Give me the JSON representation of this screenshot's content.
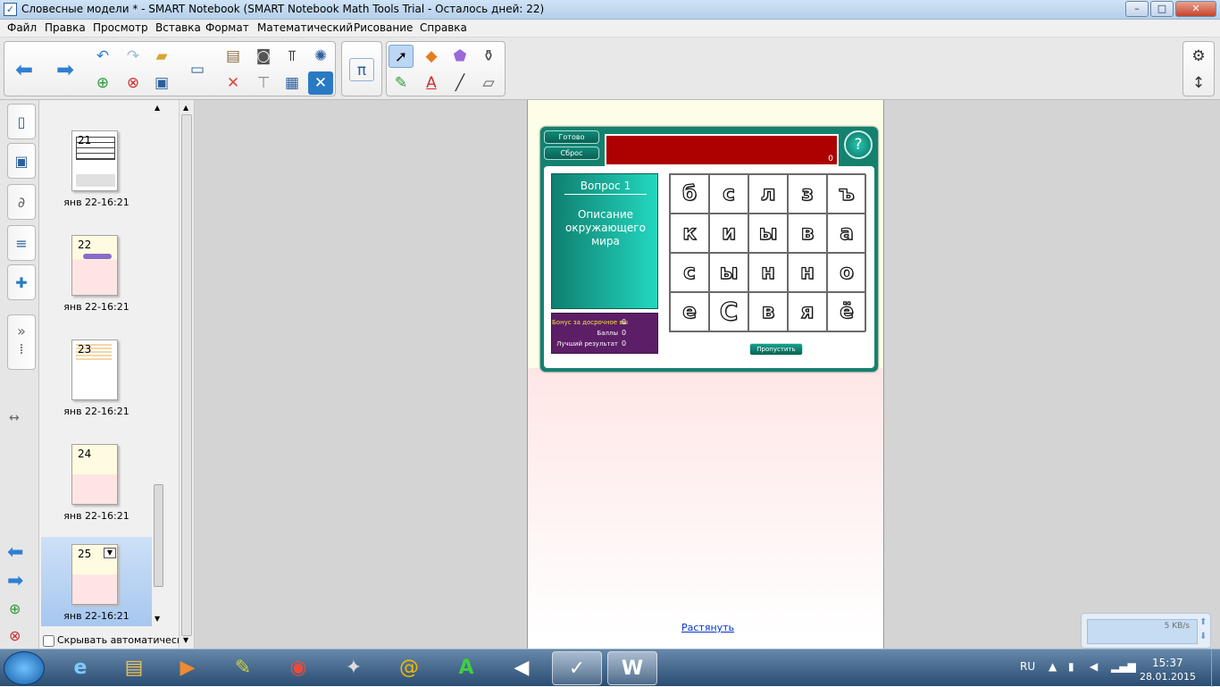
{
  "window": {
    "title": "Словесные модели * - SMART Notebook (SMART Notebook Math Tools Trial - Осталось дней: 22)",
    "minimize": "–",
    "maximize": "□",
    "close": "✕"
  },
  "menu": [
    "Файл",
    "Правка",
    "Просмотр",
    "Вставка",
    "Формат",
    "Математический",
    "Рисование",
    "Справка"
  ],
  "toolbar": {
    "math_label": "π",
    "text_label": "A"
  },
  "slides": [
    {
      "number": "21",
      "timestamp": "янв 22-16:21"
    },
    {
      "number": "22",
      "timestamp": "янв 22-16:21"
    },
    {
      "number": "23",
      "timestamp": "янв 22-16:21"
    },
    {
      "number": "24",
      "timestamp": "янв 22-16:21"
    },
    {
      "number": "25",
      "timestamp": "янв 22-16:21"
    }
  ],
  "sorter": {
    "autohide_label": "Скрывать автоматическ",
    "selected_slide": "25"
  },
  "game": {
    "ready_button": "Готово",
    "reset_button": "Сброс",
    "answer_count": "0",
    "help_label": "?",
    "question_title": "Вопрос 1",
    "question_text": "Описание окружающего мира",
    "bonus_label": "Бонус за досрочное вы",
    "bonus_value": "0",
    "score_label": "Баллы",
    "score_value": "0",
    "best_label": "Лучший результат",
    "best_value": "0",
    "skip_button": "Пропустить",
    "grid": [
      [
        "б",
        "с",
        "л",
        "з",
        "ъ"
      ],
      [
        "к",
        "и",
        "ы",
        "в",
        "а"
      ],
      [
        "с",
        "ы",
        "н",
        "н",
        "о"
      ],
      [
        "е",
        "С",
        "в",
        "я",
        "ё"
      ]
    ]
  },
  "page": {
    "stretch_link": "Растянуть"
  },
  "network": {
    "speed": "5 KB/s"
  },
  "taskbar": {
    "language": "RU",
    "time": "15:37",
    "date": "28.01.2015",
    "active_app": "SMART Notebook"
  }
}
